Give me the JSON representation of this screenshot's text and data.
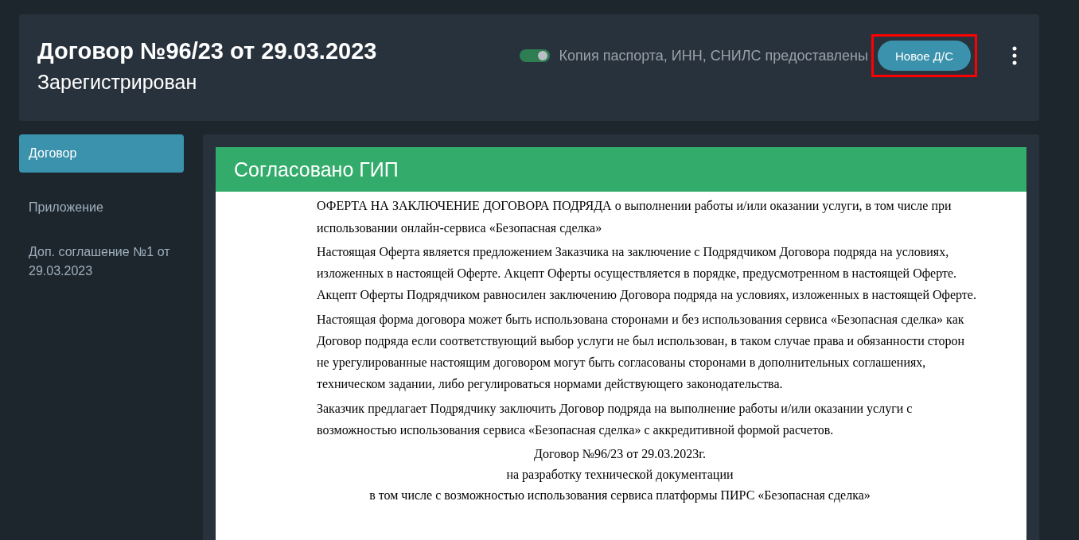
{
  "header": {
    "title": "Договор №96/23 от 29.03.2023",
    "status": "Зарегистрирован",
    "toggle": {
      "label": "Копия паспорта, ИНН, СНИЛС предоставлены",
      "on": true
    },
    "new_button": {
      "label": "Новое Д/С",
      "highlighted": true
    }
  },
  "sidebar": {
    "items": [
      {
        "label": "Договор",
        "selected": true
      },
      {
        "label": "Приложение",
        "selected": false
      },
      {
        "label": "Доп. соглашение №1 от 29.03.2023",
        "selected": false
      }
    ]
  },
  "document": {
    "banner": "Согласовано ГИП",
    "paragraphs": [
      "ОФЕРТА НА ЗАКЛЮЧЕНИЕ ДОГОВОРА ПОДРЯДА о выполнении работы и/или оказании услуги, в том числе при использовании онлайн-сервиса «Безопасная сделка»",
      "Настоящая Оферта является предложением Заказчика на заключение с Подрядчиком Договора подряда на условиях, изложенных в настоящей Оферте. Акцепт Оферты осуществляется в порядке, предусмотренном в настоящей Оферте. Акцепт Оферты Подрядчиком равносилен заключению Договора подряда на условиях, изложенных в настоящей Оферте.",
      "Настоящая форма договора может быть использована сторонами и без использования сервиса «Безопасная сделка» как Договор подряда если соответствующий выбор услуги не был использован, в таком случае права и обязанности сторон не урегулированные настоящим договором могут быть согласованы сторонами в дополнительных соглашениях, техническом задании, либо регулироваться нормами действующего законодательства.",
      "Заказчик предлагает Подрядчику заключить Договор подряда на выполнение работы и/или оказании услуги с возможностью использования сервиса «Безопасная сделка» с аккредитивной формой расчетов."
    ],
    "centered": [
      "Договор №96/23 от 29.03.2023г.",
      "на разработку технической документации",
      "в том числе с возможностью использования сервиса платформы ПИРС «Безопасная сделка»"
    ]
  }
}
